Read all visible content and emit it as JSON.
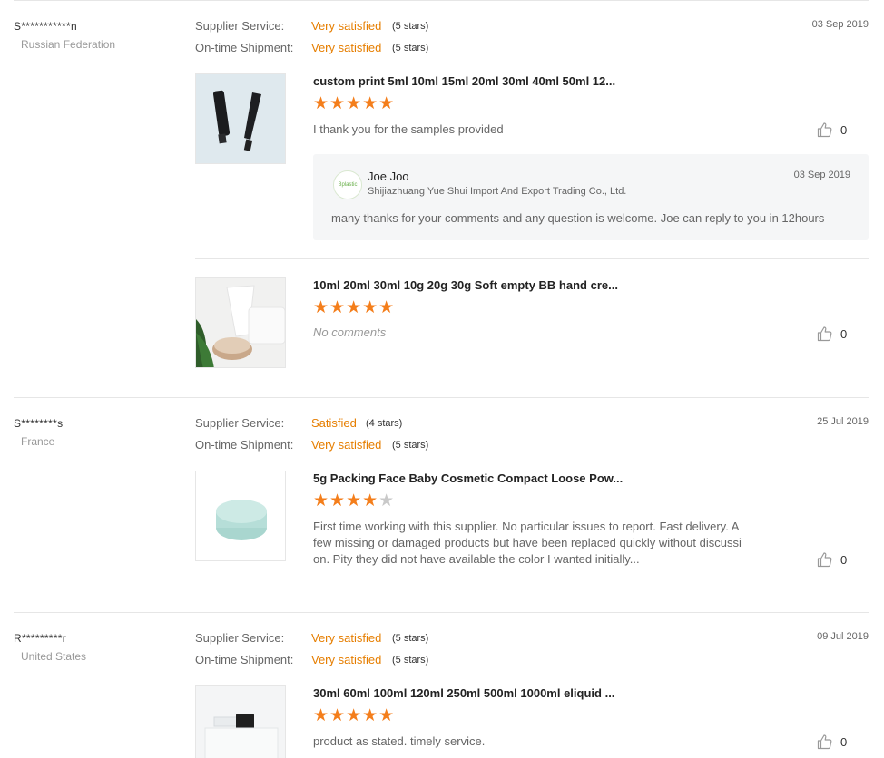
{
  "labels": {
    "supplier_service": "Supplier Service:",
    "on_time_shipment": "On-time Shipment:"
  },
  "reviews": [
    {
      "buyer": "S***********n",
      "country": "Russian Federation",
      "date": "03 Sep 2019",
      "supplier_service": {
        "text": "Very satisfied",
        "stars": "(5 stars)"
      },
      "shipment": {
        "text": "Very satisfied",
        "stars": "(5 stars)"
      },
      "products": [
        {
          "title": "custom print 5ml 10ml 15ml 20ml 30ml 40ml 50ml 12...",
          "rating": 5,
          "comment": "I thank you for the samples provided",
          "likes": "0",
          "reply": {
            "name": "Joe Joo",
            "company": "Shijiazhuang Yue Shui Import And Export Trading Co., Ltd.",
            "date": "03 Sep 2019",
            "text": "many thanks for your comments and any question is welcome. Joe can reply to you in 12hours",
            "avatar_text": "Bplastic"
          }
        },
        {
          "title": "10ml 20ml 30ml 10g 20g 30g Soft empty BB hand cre...",
          "rating": 5,
          "comment": "No comments",
          "likes": "0"
        }
      ]
    },
    {
      "buyer": "S********s",
      "country": "France",
      "date": "25 Jul 2019",
      "supplier_service": {
        "text": "Satisfied",
        "stars": "(4 stars)"
      },
      "shipment": {
        "text": "Very satisfied",
        "stars": "(5 stars)"
      },
      "products": [
        {
          "title": "5g Packing Face Baby Cosmetic Compact Loose Pow...",
          "rating": 4,
          "comment_lines": [
            "First time working with this supplier. No particular issues to report. Fast delivery. A",
            "few missing or damaged products but have been replaced quickly without discussi",
            "on. Pity they did not have available the color I wanted initially..."
          ],
          "likes": "0"
        }
      ]
    },
    {
      "buyer": "R*********r",
      "country": "United States",
      "date": "09 Jul 2019",
      "supplier_service": {
        "text": "Very satisfied",
        "stars": "(5 stars)"
      },
      "shipment": {
        "text": "Very satisfied",
        "stars": "(5 stars)"
      },
      "products": [
        {
          "title": "30ml 60ml 100ml 120ml 250ml 500ml 1000ml eliquid ...",
          "rating": 5,
          "comment": "product as stated. timely service.",
          "likes": "0"
        }
      ]
    }
  ],
  "colors": {
    "accent": "#e67e00",
    "star": "#f47e1b",
    "star_empty": "#c9c9c9"
  }
}
